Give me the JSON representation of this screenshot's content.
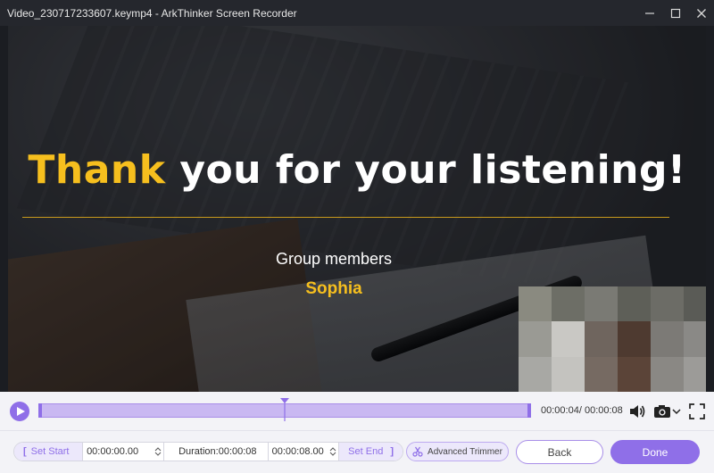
{
  "window": {
    "title": "Video_230717233607.keymp4  -  ArkThinker Screen Recorder",
    "controls": [
      "minimize-icon",
      "maximize-icon",
      "close-icon"
    ]
  },
  "video": {
    "headline_highlight": "Thank",
    "headline_rest": " you for your listening!",
    "group_label": "Group members",
    "member": "Sophia",
    "highlight_color": "#f6bf1e",
    "mosaic_colors": [
      "#8a8a80",
      "#6d6e66",
      "#7a7a74",
      "#5e5f58",
      "#6c6c66",
      "#5a5b56",
      "#9a9a94",
      "#c9c8c4",
      "#6f655e",
      "#4e3a30",
      "#7c7a76",
      "#8a8986",
      "#a8a8a4",
      "#c4c3bf",
      "#766a62",
      "#5b4438",
      "#8a8884",
      "#9c9b98"
    ]
  },
  "player": {
    "time_current": "00:00:04",
    "time_total": "00:00:08",
    "progress": 0.5,
    "icons": [
      "play-icon",
      "volume-icon",
      "camera-icon",
      "chevron-down-icon",
      "fullscreen-icon"
    ]
  },
  "trim": {
    "set_start_label": "Set Start",
    "start_time": "00:00:00.00",
    "duration_label": "Duration:00:00:08",
    "end_time": "00:00:08.00",
    "set_end_label": "Set End",
    "advanced_trimmer_label": "Advanced Trimmer",
    "back_label": "Back",
    "done_label": "Done"
  },
  "colors": {
    "accent": "#8f6fe8",
    "accent_light": "#ece8fb"
  }
}
